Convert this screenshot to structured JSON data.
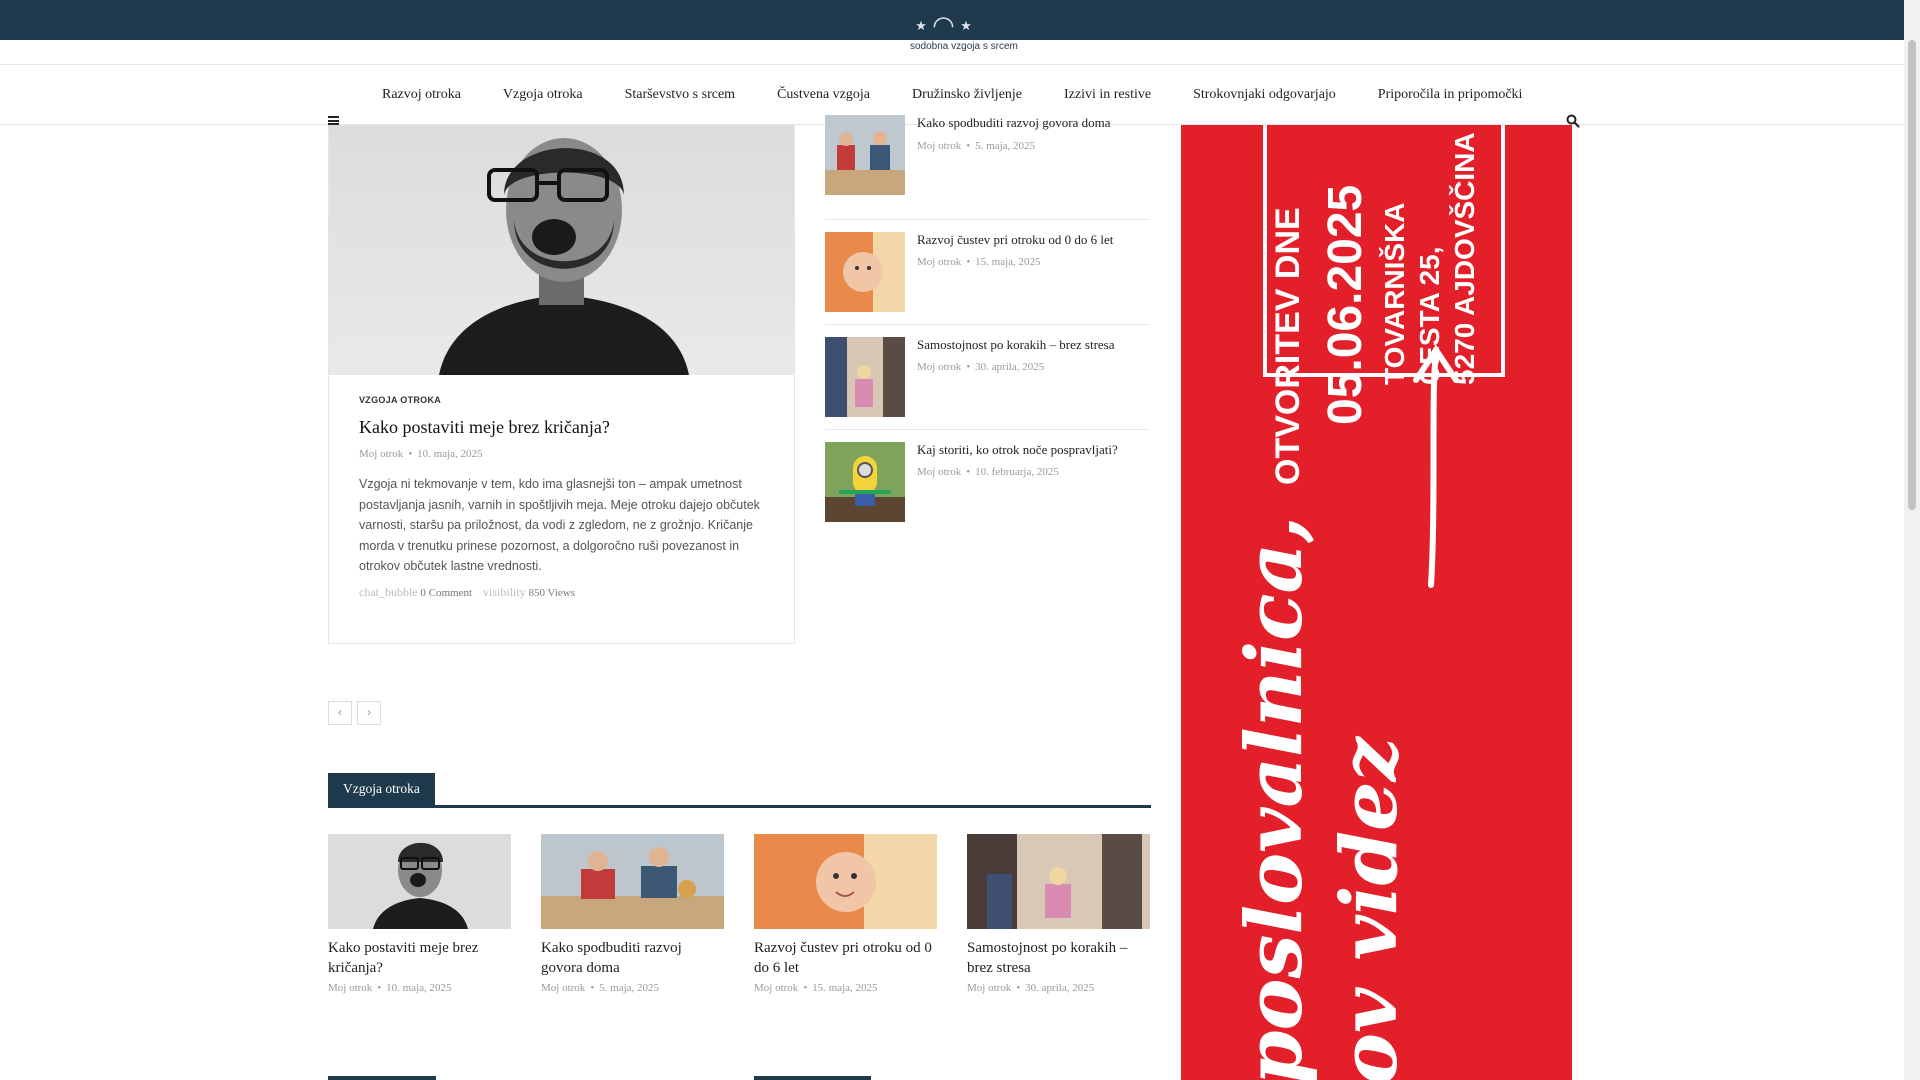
{
  "logo": {
    "tagline": "sodobna vzgoja s srcem"
  },
  "nav": {
    "items": [
      "Razvoj otroka",
      "Vzgoja otroka",
      "Starševstvo s srcem",
      "Čustvena vzgoja",
      "Družinsko življenje",
      "Izzivi in restive",
      "Strokovnjaki odgovarjajo",
      "Priporočila in pripomočki"
    ]
  },
  "featured": {
    "category": "VZGOJA OTROKA",
    "title": "Kako postaviti meje brez kričanja?",
    "author": "Moj otrok",
    "date": "10. maja, 2025",
    "excerpt": "Vzgoja ni tekmovanje v tem, kdo ima glasnejši ton – ampak umetnost postavljanja jasnih, varnih in spoštljivih meja. Meje otroku dajejo občutek varnosti, staršu pa priložnost, da vodi z zgledom, ne z grožnjo. Kričanje morda v trenutku prinese pozornost, a dolgoročno ruši povezanost in otrokov občutek lastne vrednosti.",
    "comment_icon": "chat_bubble",
    "comments": "0 Comment",
    "views_icon": "visibility",
    "views": "850 Views"
  },
  "pager": {
    "prev": "‹",
    "next": "›"
  },
  "side_posts": [
    {
      "title": "Kako spodbuditi razvoj govora doma",
      "author": "Moj otrok",
      "date": "5. maja, 2025"
    },
    {
      "title": "Razvoj čustev pri otroku od 0 do 6 let",
      "author": "Moj otrok",
      "date": "15. maja, 2025"
    },
    {
      "title": "Samostojnost po korakih – brez stresa",
      "author": "Moj otrok",
      "date": "30. aprila, 2025"
    },
    {
      "title": "Kaj storiti, ko otrok noče pospravljati?",
      "author": "Moj otrok",
      "date": "10. februarja, 2025"
    }
  ],
  "ad": {
    "line1": "OTVORITEV DNE",
    "line2": "05.06.2025",
    "line3": "TOVARNIŠKA",
    "line4": "CESTA 25,",
    "line5": "5270 AJDOVŠČINA",
    "script1": "poslovalnica,",
    "script2": "ov videz",
    "bg_color": "#e3202a"
  },
  "section": {
    "title": "Vzgoja otroka"
  },
  "grid_posts": [
    {
      "title": "Kako postaviti meje brez kričanja?",
      "author": "Moj otrok",
      "date": "10. maja, 2025"
    },
    {
      "title": "Kako spodbuditi razvoj govora doma",
      "author": "Moj otrok",
      "date": "5. maja, 2025"
    },
    {
      "title": "Razvoj čustev pri otroku od 0 do 6 let",
      "author": "Moj otrok",
      "date": "15. maja, 2025"
    },
    {
      "title": "Samostojnost po korakih – brez stresa",
      "author": "Moj otrok",
      "date": "30. aprila, 2025"
    }
  ],
  "colors": {
    "brand": "#1e3a4c",
    "ad": "#e3202a"
  }
}
